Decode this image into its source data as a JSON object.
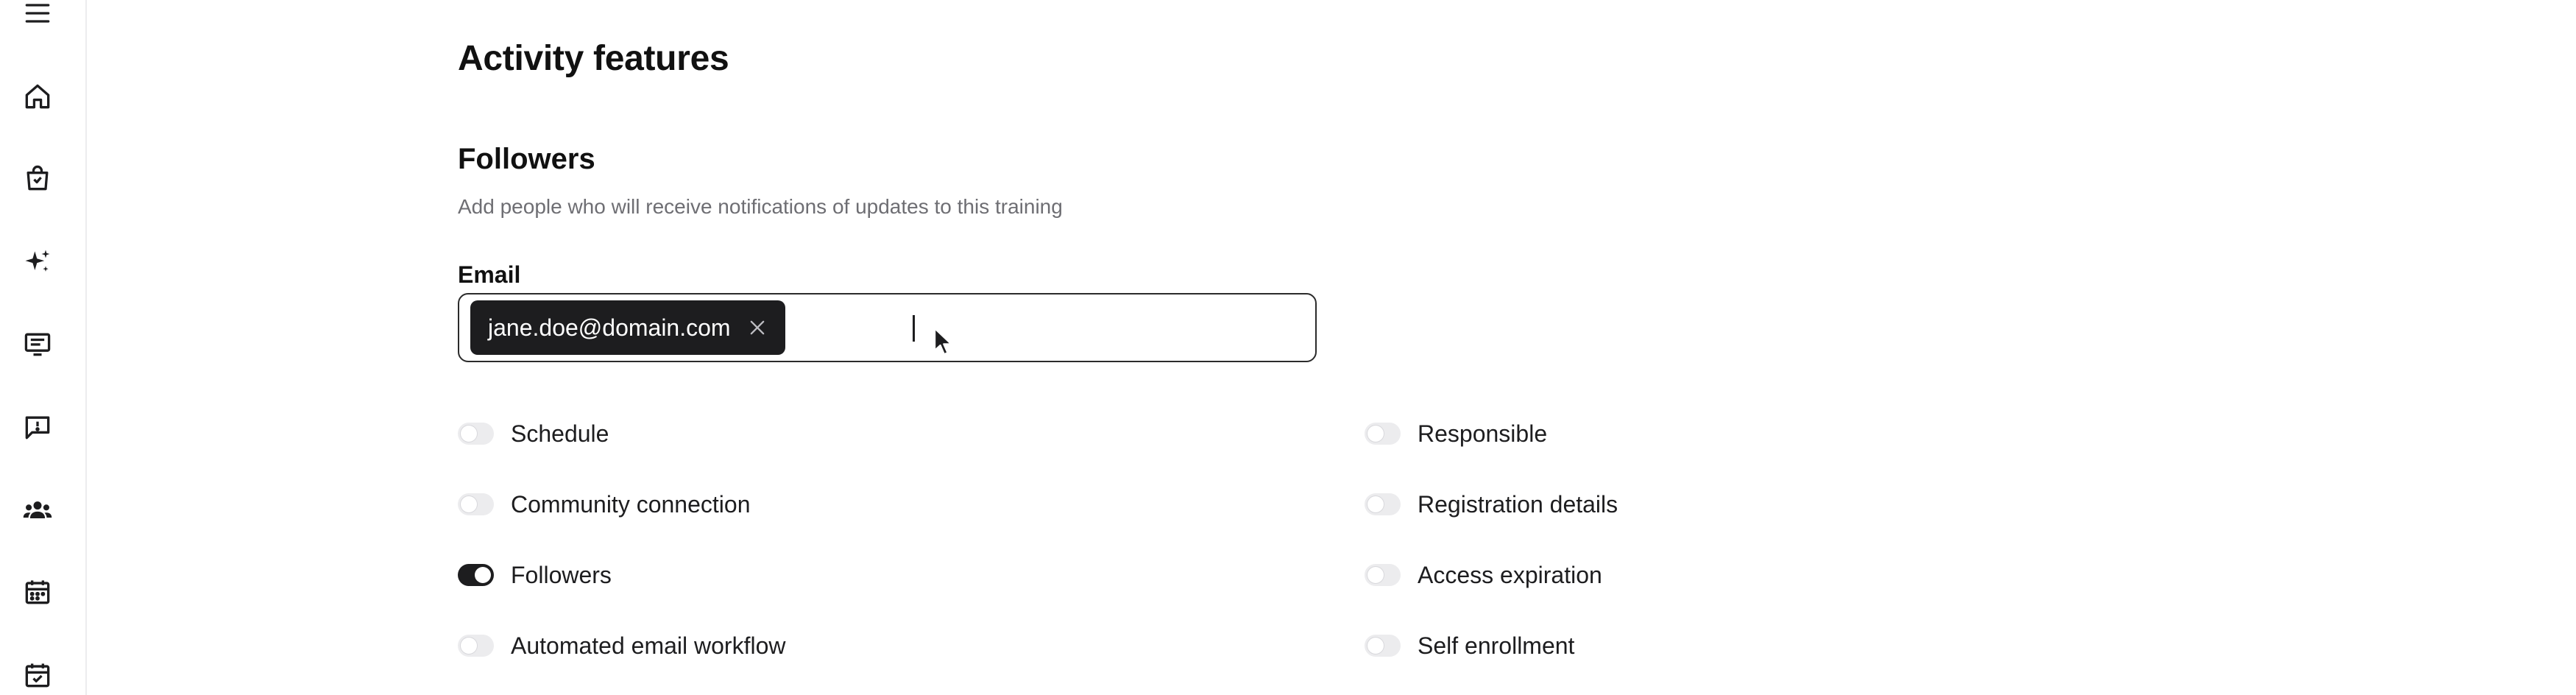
{
  "page": {
    "title": "Activity features"
  },
  "followers": {
    "title": "Followers",
    "description": "Add people who will receive notifications of updates to this training",
    "email_label": "Email",
    "chips": [
      "jane.doe@domain.com"
    ],
    "input_value": ""
  },
  "toggles": {
    "left": [
      {
        "label": "Schedule",
        "on": false
      },
      {
        "label": "Community connection",
        "on": false
      },
      {
        "label": "Followers",
        "on": true
      },
      {
        "label": "Automated email workflow",
        "on": false
      }
    ],
    "right": [
      {
        "label": "Responsible",
        "on": false
      },
      {
        "label": "Registration details",
        "on": false
      },
      {
        "label": "Access expiration",
        "on": false
      },
      {
        "label": "Self enrollment",
        "on": false
      }
    ]
  },
  "sidebar": {
    "icons": [
      "menu-icon",
      "home-icon",
      "shopping-bag-icon",
      "sparkles-icon",
      "content-icon",
      "feedback-icon",
      "people-icon",
      "calendar-icon",
      "calendar-check-icon"
    ]
  },
  "colors": {
    "accent": "#1d1d1f",
    "muted_text": "#6e6e73",
    "toggle_off": "#ececee"
  }
}
